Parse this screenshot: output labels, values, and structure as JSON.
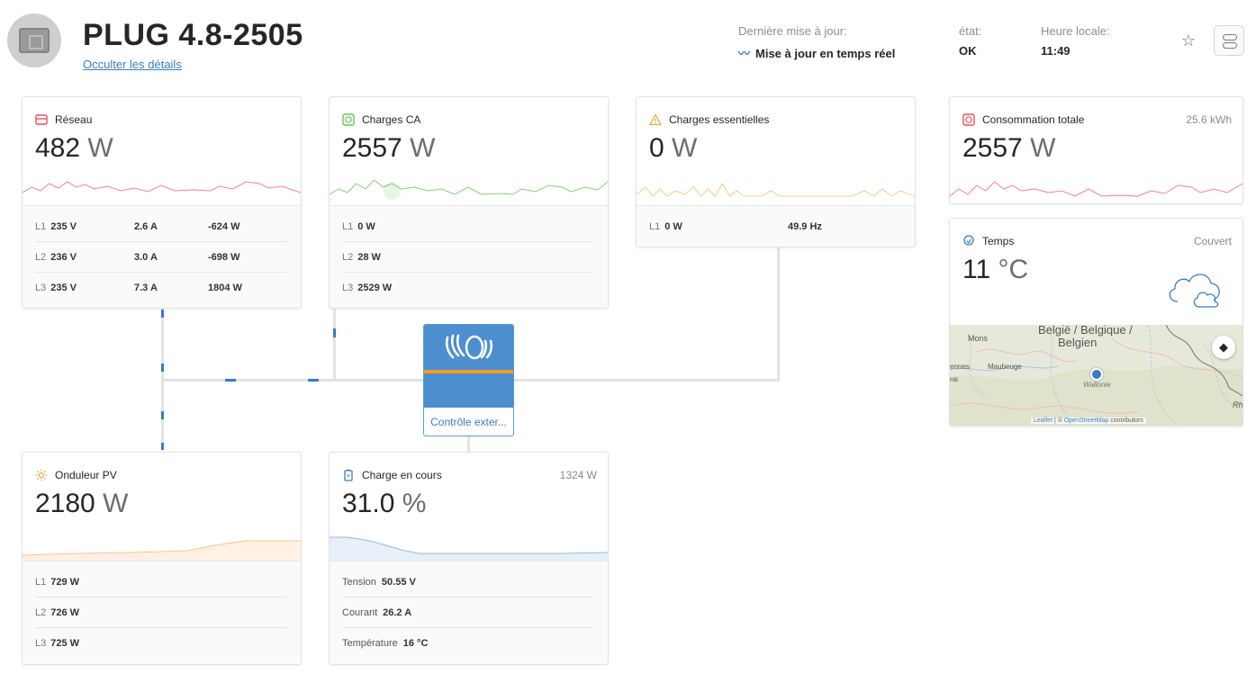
{
  "header": {
    "title": "PLUG 4.8-2505",
    "hide_details": "Occulter les détails",
    "last_update_label": "Dernière mise à jour:",
    "last_update_value": "Mise à jour en temps réel",
    "state_label": "état:",
    "state_value": "OK",
    "local_time_label": "Heure locale:",
    "local_time_value": "11:49"
  },
  "cards": {
    "grid": {
      "title": "Réseau",
      "value": "482",
      "unit": "W",
      "accent": "#e8535a",
      "rows": [
        {
          "phase": "L1",
          "v": "235 V",
          "a": "2.6 A",
          "w": "-624 W"
        },
        {
          "phase": "L2",
          "v": "236 V",
          "a": "3.0 A",
          "w": "-698 W"
        },
        {
          "phase": "L3",
          "v": "235 V",
          "a": "7.3 A",
          "w": "1804 W"
        }
      ]
    },
    "ac_loads": {
      "title": "Charges CA",
      "value": "2557",
      "unit": "W",
      "accent": "#6cc15e",
      "rows": [
        {
          "phase": "L1",
          "val": "0 W"
        },
        {
          "phase": "L2",
          "val": "28 W"
        },
        {
          "phase": "L3",
          "val": "2529 W"
        }
      ]
    },
    "essential": {
      "title": "Charges essentielles",
      "value": "0",
      "unit": "W",
      "accent": "#f5a445",
      "rows": [
        {
          "phase": "L1",
          "val": "0 W",
          "hz": "49.9 Hz"
        }
      ]
    },
    "total": {
      "title": "Consommation totale",
      "extra": "25.6 kWh",
      "value": "2557",
      "unit": "W",
      "accent": "#e8535a"
    },
    "weather": {
      "title": "Temps",
      "extra": "Couvert",
      "value": "11",
      "unit": "°C",
      "map_country": "België / Belgique /",
      "map_country2": "Belgien",
      "map_city1": "Mons",
      "map_city2": "Maubeuge",
      "map_city3": "Wallonie",
      "map_edge1": "ennes",
      "map_edge2": "rai",
      "map_edge3": "Rh",
      "attribution_leaflet": "Leaflet",
      "attribution_sep": " | © ",
      "attribution_osm": "OpenStreetMap",
      "attribution_rest": " contributors"
    },
    "pv": {
      "title": "Onduleur PV",
      "value": "2180",
      "unit": "W",
      "accent": "#f5a445",
      "rows": [
        {
          "phase": "L1",
          "val": "729 W"
        },
        {
          "phase": "L2",
          "val": "726 W"
        },
        {
          "phase": "L3",
          "val": "725 W"
        }
      ]
    },
    "battery": {
      "title": "Charge en cours",
      "extra": "1324 W",
      "value": "31.0",
      "unit": "%",
      "accent": "#387dc5",
      "rows": [
        {
          "label": "Tension",
          "val": "50.55 V"
        },
        {
          "label": "Courant",
          "val": "26.2 A"
        },
        {
          "label": "Température",
          "val": "16 °C"
        }
      ]
    }
  },
  "inverter": {
    "label": "Contrôle exter..."
  }
}
